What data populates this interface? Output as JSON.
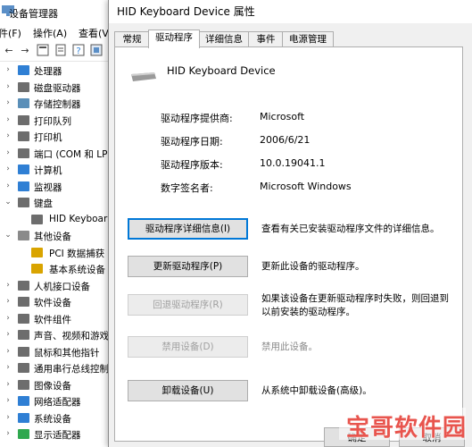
{
  "device_manager": {
    "title": "设备管理器",
    "menu": [
      "件(F)",
      "操作(A)",
      "查看(V)"
    ],
    "tree": [
      {
        "label": "处理器",
        "icon": "cpu-icon",
        "color": "#2f7fd4",
        "indent": 1,
        "chevron": "›"
      },
      {
        "label": "磁盘驱动器",
        "icon": "disk-drive-icon",
        "color": "#6d6d6d",
        "indent": 1,
        "chevron": "›"
      },
      {
        "label": "存储控制器",
        "icon": "storage-controller-icon",
        "color": "#5a8fb8",
        "indent": 1,
        "chevron": "›"
      },
      {
        "label": "打印队列",
        "icon": "print-queue-icon",
        "color": "#6d6d6d",
        "indent": 1,
        "chevron": "›"
      },
      {
        "label": "打印机",
        "icon": "printer-icon",
        "color": "#6d6d6d",
        "indent": 1,
        "chevron": "›"
      },
      {
        "label": "端口 (COM 和 LP",
        "icon": "port-icon",
        "color": "#6d6d6d",
        "indent": 1,
        "chevron": "›"
      },
      {
        "label": "计算机",
        "icon": "computer-icon",
        "color": "#2f7fd4",
        "indent": 1,
        "chevron": "›"
      },
      {
        "label": "监视器",
        "icon": "monitor-icon",
        "color": "#2f7fd4",
        "indent": 1,
        "chevron": "›"
      },
      {
        "label": "键盘",
        "icon": "keyboard-icon",
        "color": "#6d6d6d",
        "indent": 1,
        "chevron": "⌄"
      },
      {
        "label": "HID Keyboar",
        "icon": "keyboard-device-icon",
        "color": "#6d6d6d",
        "indent": 2,
        "chevron": ""
      },
      {
        "label": "其他设备",
        "icon": "other-devices-icon",
        "color": "#8a8a8a",
        "indent": 1,
        "chevron": "⌄"
      },
      {
        "label": "PCI 数据捕获",
        "icon": "warning-device-icon",
        "color": "#d9a400",
        "indent": 2,
        "chevron": ""
      },
      {
        "label": "基本系统设备",
        "icon": "warning-device-icon",
        "color": "#d9a400",
        "indent": 2,
        "chevron": ""
      },
      {
        "label": "人机接口设备",
        "icon": "hid-icon",
        "color": "#6d6d6d",
        "indent": 1,
        "chevron": "›"
      },
      {
        "label": "软件设备",
        "icon": "software-device-icon",
        "color": "#6d6d6d",
        "indent": 1,
        "chevron": "›"
      },
      {
        "label": "软件组件",
        "icon": "software-component-icon",
        "color": "#6d6d6d",
        "indent": 1,
        "chevron": "›"
      },
      {
        "label": "声音、视频和游戏",
        "icon": "sound-icon",
        "color": "#6d6d6d",
        "indent": 1,
        "chevron": "›"
      },
      {
        "label": "鼠标和其他指针",
        "icon": "mouse-icon",
        "color": "#6d6d6d",
        "indent": 1,
        "chevron": "›"
      },
      {
        "label": "通用串行总线控制",
        "icon": "usb-icon",
        "color": "#6d6d6d",
        "indent": 1,
        "chevron": "›"
      },
      {
        "label": "图像设备",
        "icon": "camera-icon",
        "color": "#6d6d6d",
        "indent": 1,
        "chevron": "›"
      },
      {
        "label": "网络适配器",
        "icon": "network-icon",
        "color": "#2f7fd4",
        "indent": 1,
        "chevron": "›"
      },
      {
        "label": "系统设备",
        "icon": "system-device-icon",
        "color": "#2f7fd4",
        "indent": 1,
        "chevron": "›"
      },
      {
        "label": "显示适配器",
        "icon": "display-adapter-icon",
        "color": "#2fa84f",
        "indent": 1,
        "chevron": "›"
      }
    ]
  },
  "dialog": {
    "title": "HID Keyboard Device 属性",
    "tabs": [
      {
        "label": "常规",
        "active": false
      },
      {
        "label": "驱动程序",
        "active": true
      },
      {
        "label": "详细信息",
        "active": false
      },
      {
        "label": "事件",
        "active": false
      },
      {
        "label": "电源管理",
        "active": false
      }
    ],
    "device_name": "HID Keyboard Device",
    "properties": [
      {
        "label": "驱动程序提供商:",
        "value": "Microsoft"
      },
      {
        "label": "驱动程序日期:",
        "value": "2006/6/21"
      },
      {
        "label": "驱动程序版本:",
        "value": "10.0.19041.1"
      },
      {
        "label": "数字签名者:",
        "value": "Microsoft Windows"
      }
    ],
    "actions": [
      {
        "label": "驱动程序详细信息(I)",
        "desc": "查看有关已安装驱动程序文件的详细信息。",
        "disabled": false,
        "focused": true
      },
      {
        "label": "更新驱动程序(P)",
        "desc": "更新此设备的驱动程序。",
        "disabled": false,
        "focused": false
      },
      {
        "label": "回退驱动程序(R)",
        "desc": "如果该设备在更新驱动程序时失败，则回退到以前安装的驱动程序。",
        "disabled": true,
        "focused": false
      },
      {
        "label": "禁用设备(D)",
        "desc": "禁用此设备。",
        "disabled": true,
        "focused": false
      },
      {
        "label": "卸载设备(U)",
        "desc": "从系统中卸载设备(高级)。",
        "disabled": false,
        "focused": false
      }
    ],
    "ok_label": "确定",
    "cancel_label": "取消"
  },
  "watermark": {
    "text": "宝哥软件园",
    "color": "#e8554e"
  }
}
